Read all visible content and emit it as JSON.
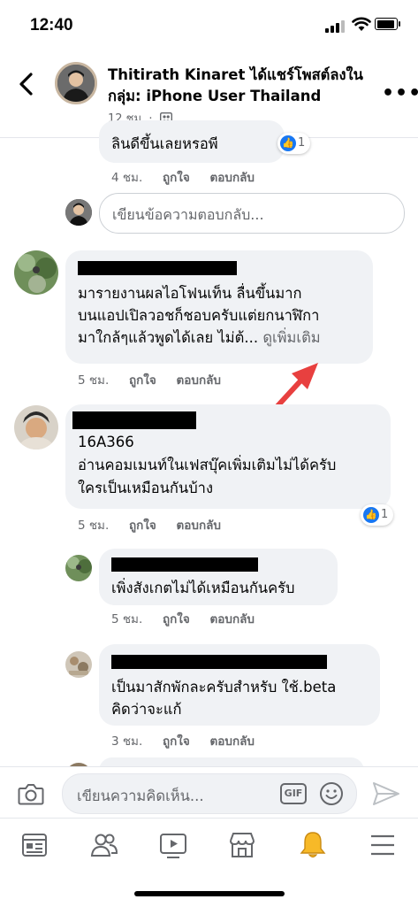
{
  "status_bar": {
    "time": "12:40"
  },
  "header": {
    "title": "Thitirath Kinaret ได้แชร์โพสต์ลงในกลุ่ม: iPhone User Thailand",
    "meta": "12 ชม. ·"
  },
  "top_comment": {
    "text": "ลินดีขึ้นเลยหรอพี",
    "time": "4 ชม.",
    "like": "ถูกใจ",
    "reply": "ตอบกลับ",
    "reaction_count": "1"
  },
  "reply_box": {
    "placeholder": "เขียนข้อความตอบกลับ..."
  },
  "comment1": {
    "line1": "มารายงานผลไอโฟนเท็น ลื่นขึ้นมาก",
    "line2": "บนแอปเปิลวอชก็ชอบครับแต่ยกนาฬิกา",
    "line3": "มาใกล้ๆแล้วพูดได้เลย ไม่ต้...",
    "see_more": "ดูเพิ่มเติม",
    "time": "5 ชม.",
    "like": "ถูกใจ",
    "reply": "ตอบกลับ"
  },
  "comment2": {
    "line1": "16A366",
    "line2": "อ่านคอมเมนท์ในเฟสบุ๊คเพิ่มเติมไม่ได้ครับ",
    "line3": "ใครเป็นเหมือนกันบ้าง",
    "time": "5 ชม.",
    "like": "ถูกใจ",
    "reply": "ตอบกลับ",
    "reaction_count": "1"
  },
  "reply1": {
    "text": "เพิ่งสังเกตไม่ได้เหมือนกันครับ",
    "time": "5 ชม.",
    "like": "ถูกใจ",
    "reply": "ตอบกลับ"
  },
  "reply2": {
    "line1": "เป็นมาสักพักละครับสำหรับ ใช้.beta",
    "line2": "คิดว่าจะแก้",
    "time": "3 ชม.",
    "like": "ถูกใจ",
    "reply": "ตอบกลับ"
  },
  "composer": {
    "placeholder": "เขียนความคิดเห็น...",
    "gif_label": "GIF"
  },
  "colors": {
    "accent": "#1877f2",
    "arrow": "#e8403f",
    "bubble": "#f0f2f5",
    "bell": "#f7b928"
  }
}
